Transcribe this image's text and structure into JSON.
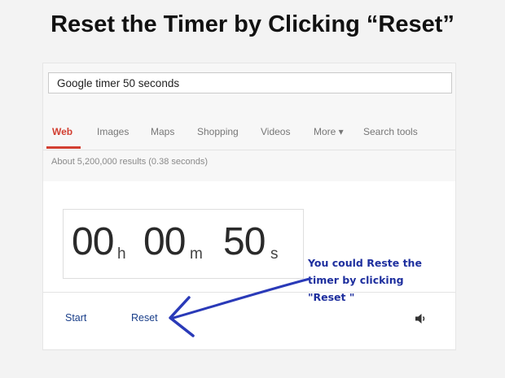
{
  "slide": {
    "title": "Reset the Timer by Clicking “Reset”"
  },
  "search": {
    "query": "Google timer 50 seconds"
  },
  "tabs": [
    {
      "label": "Web",
      "active": true
    },
    {
      "label": "Images"
    },
    {
      "label": "Maps"
    },
    {
      "label": "Shopping"
    },
    {
      "label": "Videos"
    },
    {
      "label": "More ▾"
    },
    {
      "label": "Search tools"
    }
  ],
  "result_stats": "About 5,200,000 results (0.38 seconds)",
  "timer": {
    "hours": "00",
    "hours_unit": "h",
    "minutes": "00",
    "minutes_unit": "m",
    "seconds": "50",
    "seconds_unit": "s"
  },
  "controls": {
    "start": "Start",
    "reset": "Reset",
    "sound_icon": "speaker-icon"
  },
  "annotation": {
    "line1": "You could Reste the",
    "line2": "timer by clicking",
    "line3": "\"Reset \""
  },
  "colors": {
    "active_tab": "#d23f31",
    "annotation": "#1e2f9e",
    "link": "#1a3f8a"
  }
}
